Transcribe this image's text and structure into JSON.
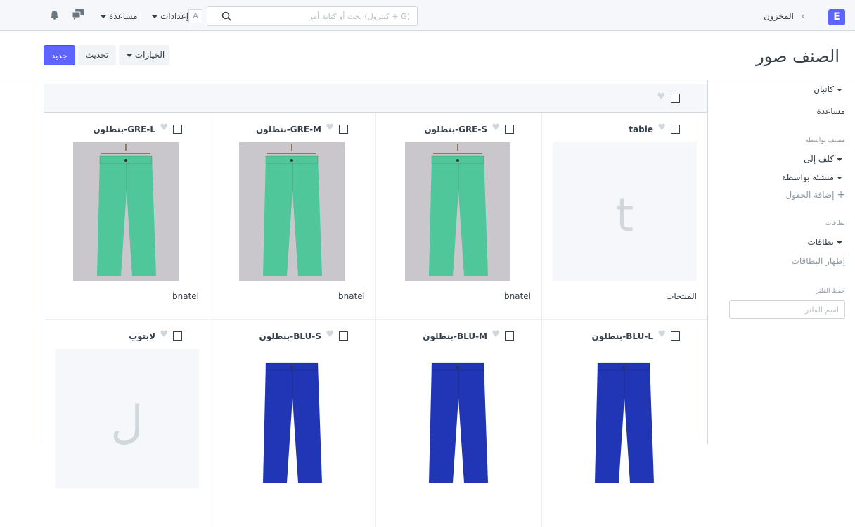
{
  "navbar": {
    "logo": "E",
    "breadcrumb": "المخزون",
    "search_placeholder": "بحث أو كتابة أمر (كنترول + G)",
    "user_initial": "A",
    "settings_label": "إعدادات",
    "help_label": "مساعدة"
  },
  "page": {
    "title": "الصنف صور",
    "new_button": "جديد",
    "refresh_button": "تحديث",
    "options_button": "الخيارات"
  },
  "sidebar": {
    "kanban": "كانبان",
    "help": "مساعدة",
    "group_by_label": "مصنف بواسطة",
    "assigned_to": "كلف إلى",
    "created_by": "منشئه بواسطة",
    "add_field": "إضافة الحقول",
    "tags_label": "بطاقات",
    "tags": "بطاقات",
    "show_tags": "إظهار البطاقات",
    "save_filter_label": "حفظ الفلتر",
    "filter_name_placeholder": "اسم الفلتر"
  },
  "cards": [
    {
      "title": "table",
      "subtitle": "المنتجات",
      "image": "placeholder",
      "letter": "t"
    },
    {
      "title": "بنطلون-GRE-S",
      "subtitle": "bnatel",
      "image": "green-pants"
    },
    {
      "title": "بنطلون-GRE-M",
      "subtitle": "bnatel",
      "image": "green-pants"
    },
    {
      "title": "بنطلون-GRE-L",
      "subtitle": "bnatel",
      "image": "green-pants"
    },
    {
      "title": "بنطلون-BLU-L",
      "subtitle": "",
      "image": "blue-pants"
    },
    {
      "title": "بنطلون-BLU-M",
      "subtitle": "",
      "image": "blue-pants"
    },
    {
      "title": "بنطلون-BLU-S",
      "subtitle": "",
      "image": "blue-pants"
    },
    {
      "title": "لابتوب",
      "subtitle": "",
      "image": "placeholder",
      "letter": "ل"
    }
  ],
  "colors": {
    "primary": "#5e64ff",
    "green_pants": "#4fc79a",
    "blue_pants": "#2136b5"
  }
}
